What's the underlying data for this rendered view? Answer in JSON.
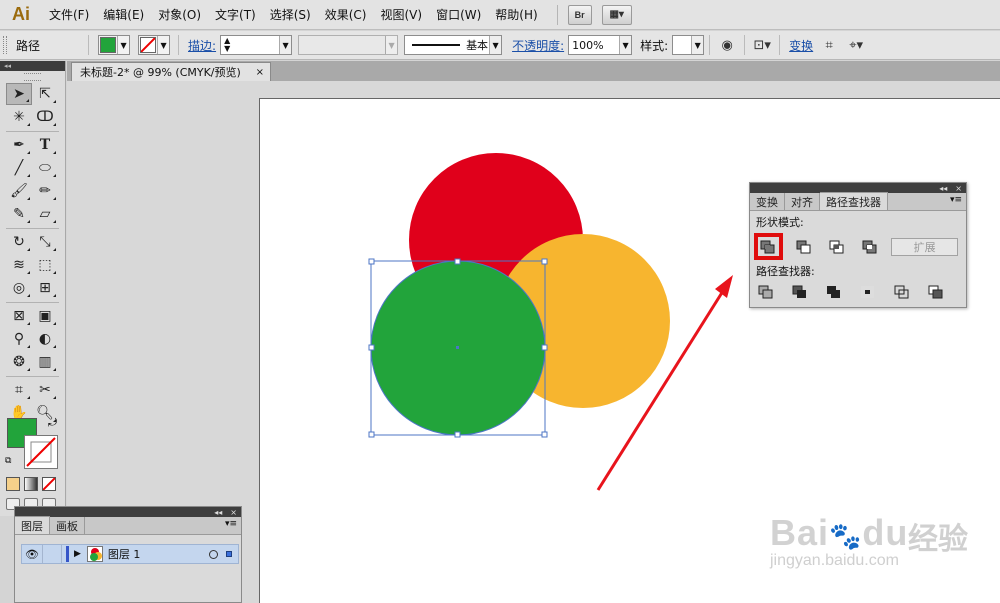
{
  "app": {
    "logo": "Ai",
    "bridge_label": "Br"
  },
  "menu": {
    "items": [
      "文件(F)",
      "编辑(E)",
      "对象(O)",
      "文字(T)",
      "选择(S)",
      "效果(C)",
      "视图(V)",
      "窗口(W)",
      "帮助(H)"
    ]
  },
  "control_bar": {
    "selection_label": "路径",
    "stroke_label": "描边:",
    "stroke_profile": "基本",
    "opacity_label": "不透明度:",
    "opacity_value": "100%",
    "style_label": "样式:",
    "transform_label": "变换",
    "fill_color": "#22a43b"
  },
  "document": {
    "tab_title": "未标题-2* @ 99% (CMYK/预览)",
    "tab_close": "×"
  },
  "canvas": {
    "circles": [
      {
        "name": "red",
        "color": "#e0001b"
      },
      {
        "name": "orange",
        "color": "#f7b52f"
      },
      {
        "name": "green",
        "color": "#22a43b"
      }
    ],
    "selection_color": "#4c76c6",
    "annotation_color": "#e8141c"
  },
  "pathfinder_panel": {
    "tabs": [
      "变换",
      "对齐",
      "路径查找器"
    ],
    "active_tab": 2,
    "shape_modes_label": "形状模式:",
    "expand_label": "扩展",
    "pathfinders_label": "路径查找器:",
    "collapse_glyph": "◂◂",
    "close_glyph": "×",
    "menu_glyph": "▾≡"
  },
  "layers_panel": {
    "tabs": [
      "图层",
      "画板"
    ],
    "layer_name": "图层 1"
  },
  "toolbox": {
    "collapse_glyph": "◂◂",
    "fill_color": "#22a43b"
  },
  "watermark": {
    "main": "Bai",
    "main2": "du",
    "cn": "经验",
    "sub": "jingyan.baidu.com"
  }
}
